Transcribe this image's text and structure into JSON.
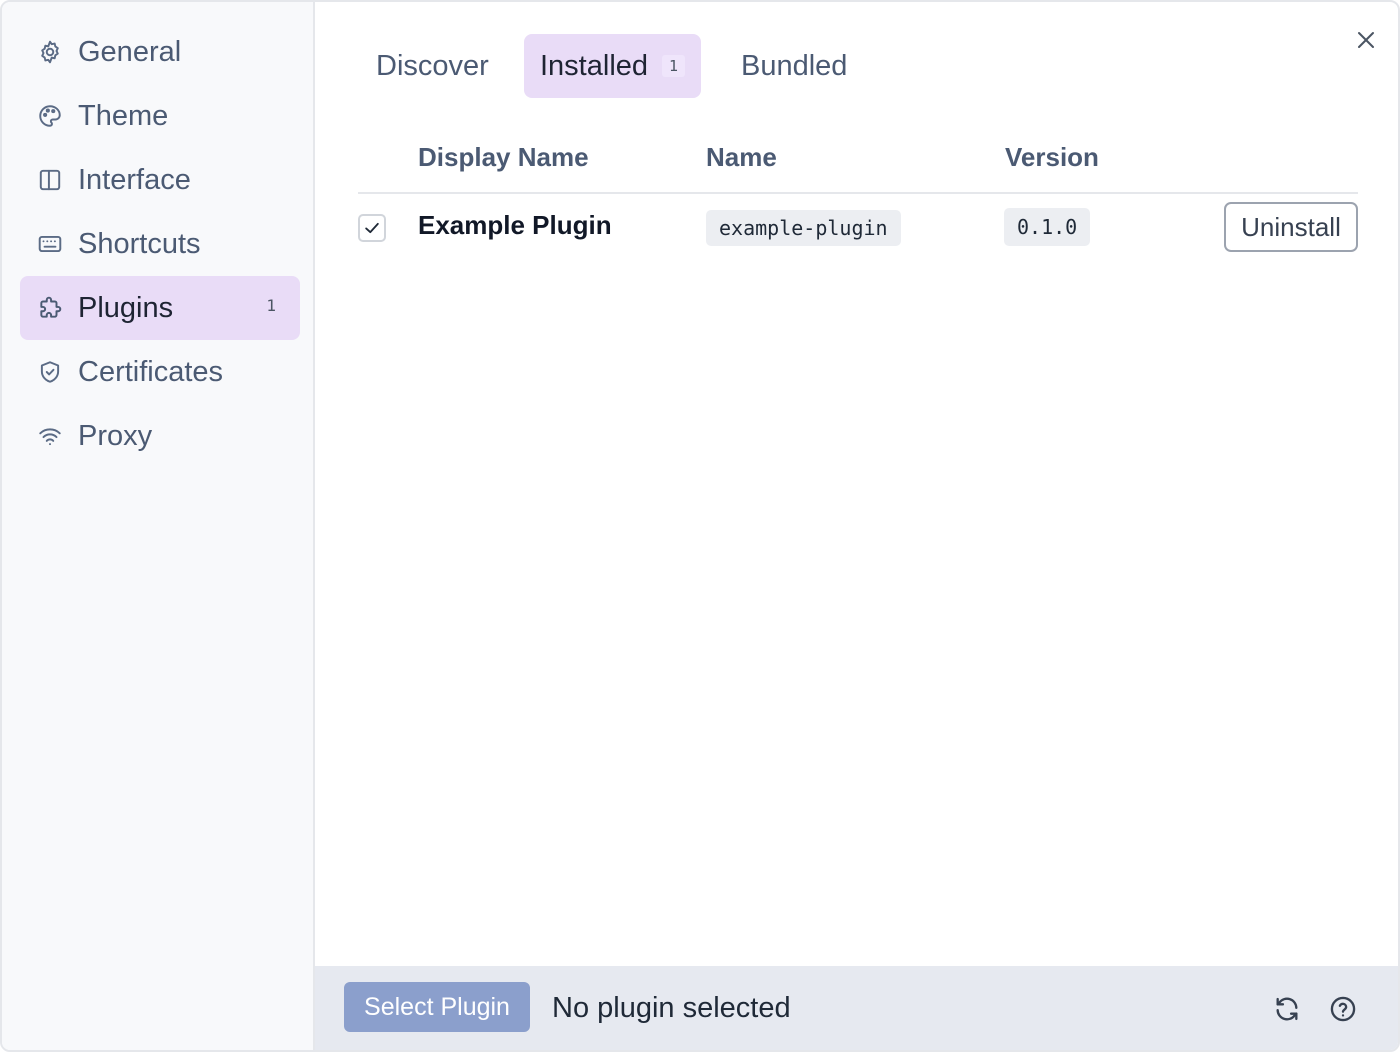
{
  "sidebar": {
    "items": [
      {
        "label": "General",
        "icon": "gear-icon"
      },
      {
        "label": "Theme",
        "icon": "palette-icon"
      },
      {
        "label": "Interface",
        "icon": "layout-icon"
      },
      {
        "label": "Shortcuts",
        "icon": "keyboard-icon"
      },
      {
        "label": "Plugins",
        "icon": "puzzle-icon",
        "badge": "1",
        "active": true
      },
      {
        "label": "Certificates",
        "icon": "shield-icon"
      },
      {
        "label": "Proxy",
        "icon": "wifi-icon"
      }
    ]
  },
  "tabs": [
    {
      "label": "Discover"
    },
    {
      "label": "Installed",
      "badge": "1",
      "active": true
    },
    {
      "label": "Bundled"
    }
  ],
  "table": {
    "headers": {
      "display_name": "Display Name",
      "name": "Name",
      "version": "Version"
    },
    "rows": [
      {
        "checked": true,
        "display_name": "Example Plugin",
        "name": "example-plugin",
        "version": "0.1.0",
        "action": "Uninstall"
      }
    ]
  },
  "footer": {
    "select_button": "Select Plugin",
    "status": "No plugin selected"
  },
  "colors": {
    "accent": "#e9dcf7",
    "select_button": "#8b9fcc",
    "footer_bg": "#e6e9f0",
    "sidebar_bg": "#f8f9fb"
  }
}
